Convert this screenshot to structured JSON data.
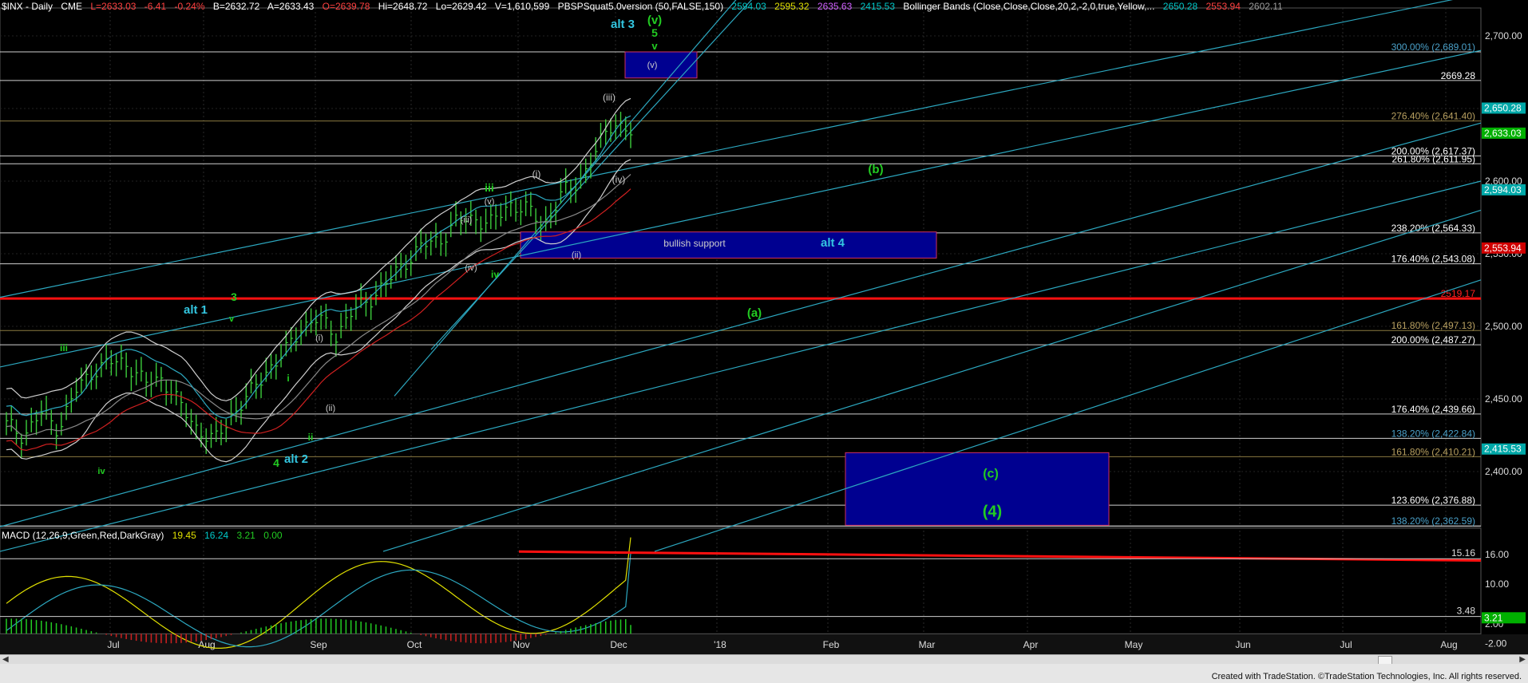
{
  "header": {
    "symbol": "$INX - Daily",
    "exchange": "CME",
    "last": "L=2633.03",
    "change": "-6.41",
    "change_pct": "-0.24%",
    "bid": "B=2632.72",
    "ask": "A=2633.43",
    "open": "O=2639.78",
    "high": "Hi=2648.72",
    "low": "Lo=2629.42",
    "volume": "V=1,610,599",
    "study1": "PBSPSquat5.0version (50,FALSE,150)",
    "study1_vals": [
      "2594.03",
      "2595.32",
      "2635.63",
      "2415.53"
    ],
    "study2": "Bollinger Bands (Close,Close,Close,20,2,-2,0,true,Yellow,...",
    "study2_vals": [
      "2650.28",
      "2553.94",
      "2602.11"
    ]
  },
  "macd_header": {
    "label": "MACD (12,26,9,Green,Red,DarkGray)",
    "vals": [
      "19.45",
      "16.24",
      "3.21",
      "0.00"
    ]
  },
  "price_axis": {
    "ticks": [
      "2,700.00",
      "2,650.00",
      "2,600.00",
      "2,550.00",
      "2,500.00",
      "2,450.00",
      "2,400.00"
    ],
    "flags": [
      {
        "text": "2,650.28",
        "bg": "#00a8a8"
      },
      {
        "text": "2,633.03",
        "bg": "#00b000"
      },
      {
        "text": "2,594.03",
        "bg": "#00a8a8"
      },
      {
        "text": "2,553.94",
        "bg": "#d00000"
      },
      {
        "text": "2,415.53",
        "bg": "#00a8a8"
      }
    ]
  },
  "macd_axis": {
    "ticks": [
      "16.00",
      "10.00",
      "2.00",
      "-2.00"
    ],
    "flags": [
      {
        "text": "3.21",
        "bg": "#00b000"
      }
    ],
    "right_labels": [
      "15.16",
      "3.48"
    ]
  },
  "time_axis": [
    "Jul",
    "Aug",
    "Sep",
    "Oct",
    "Nov",
    "Dec",
    "'18",
    "Feb",
    "Mar",
    "Apr",
    "May",
    "Jun",
    "Jul",
    "Aug"
  ],
  "fib_levels": [
    {
      "label": "300.00% (2,689.01)",
      "price": 2689.01,
      "color": "#4aa0c8"
    },
    {
      "label": "2669.28",
      "price": 2669.28,
      "color": "#ffffff"
    },
    {
      "label": "276.40% (2,641.40)",
      "price": 2641.4,
      "color": "#b8a060"
    },
    {
      "label": "200.00% (2,617.37)",
      "price": 2617.37,
      "color": "#ffffff"
    },
    {
      "label": "261.80% (2,611.95)",
      "price": 2611.95,
      "color": "#ffffff"
    },
    {
      "label": "238.20% (2,564.33)",
      "price": 2564.33,
      "color": "#ffffff"
    },
    {
      "label": "176.40% (2,543.08)",
      "price": 2543.08,
      "color": "#ffffff"
    },
    {
      "label": "2519.17",
      "price": 2519.17,
      "color": "#ff2020"
    },
    {
      "label": "161.80% (2,497.13)",
      "price": 2497.13,
      "color": "#b8a060"
    },
    {
      "label": "200.00% (2,487.27)",
      "price": 2487.27,
      "color": "#ffffff"
    },
    {
      "label": "176.40% (2,439.66)",
      "price": 2439.66,
      "color": "#ffffff"
    },
    {
      "label": "138.20% (2,422.84)",
      "price": 2422.84,
      "color": "#4aa0c8"
    },
    {
      "label": "161.80% (2,410.21)",
      "price": 2410.21,
      "color": "#b8a060"
    },
    {
      "label": "123.60% (2,376.88)",
      "price": 2376.88,
      "color": "#ffffff"
    },
    {
      "label": "138.20% (2,362.59)",
      "price": 2362.59,
      "color": "#4aa0c8"
    }
  ],
  "boxes": {
    "target_v": "(v)",
    "bullish_support": "bullish support",
    "alt4": "alt 4",
    "target_c": "(c)",
    "target_4": "(4)"
  },
  "wave_labels": [
    {
      "t": "alt 3",
      "color": "#33c6e0"
    },
    {
      "t": "(v)",
      "color": "#22cc22"
    },
    {
      "t": "5",
      "color": "#22cc22"
    },
    {
      "t": "v",
      "color": "#22cc22"
    },
    {
      "t": "(iii)",
      "color": "#cccccc"
    },
    {
      "t": "(iv)",
      "color": "#cccccc"
    },
    {
      "t": "(i)",
      "color": "#cccccc"
    },
    {
      "t": "iii",
      "color": "#22cc22"
    },
    {
      "t": "(v)",
      "color": "#cccccc"
    },
    {
      "t": "(iii)",
      "color": "#cccccc"
    },
    {
      "t": "(iv)",
      "color": "#cccccc"
    },
    {
      "t": "iv",
      "color": "#22cc22"
    },
    {
      "t": "(ii)",
      "color": "#cccccc"
    },
    {
      "t": "(b)",
      "color": "#22cc22"
    },
    {
      "t": "(a)",
      "color": "#22cc22"
    },
    {
      "t": "alt 1",
      "color": "#33c6e0"
    },
    {
      "t": "3",
      "color": "#22cc22"
    },
    {
      "t": "v",
      "color": "#22cc22"
    },
    {
      "t": "iii",
      "color": "#22cc22"
    },
    {
      "t": "(i)",
      "color": "#cccccc"
    },
    {
      "t": "i",
      "color": "#22cc22"
    },
    {
      "t": "(ii)",
      "color": "#cccccc"
    },
    {
      "t": "ii",
      "color": "#22cc22"
    },
    {
      "t": "4",
      "color": "#22cc22"
    },
    {
      "t": "alt 2",
      "color": "#33c6e0"
    },
    {
      "t": "iv",
      "color": "#22cc22"
    }
  ],
  "chart_data": {
    "type": "bar",
    "title": "$INX - Daily",
    "ylim": [
      2345,
      2725
    ],
    "series": [
      {
        "name": "$INX",
        "approx_closes": [
          2432,
          2425,
          2440,
          2430,
          2455,
          2470,
          2475,
          2475,
          2460,
          2465,
          2445,
          2430,
          2420,
          2440,
          2452,
          2470,
          2480,
          2500,
          2505,
          2495,
          2510,
          2520,
          2530,
          2545,
          2555,
          2560,
          2572,
          2575,
          2570,
          2585,
          2580,
          2570,
          2590,
          2600,
          2620,
          2642,
          2633
        ]
      },
      {
        "name": "MACD",
        "values": [
          19.45
        ]
      },
      {
        "name": "Signal",
        "values": [
          16.24
        ]
      },
      {
        "name": "Histogram",
        "values": [
          3.21
        ]
      }
    ],
    "x_labels": [
      "Jul",
      "Aug",
      "Sep",
      "Oct",
      "Nov",
      "Dec",
      "'18",
      "Feb",
      "Mar",
      "Apr",
      "May",
      "Jun",
      "Jul",
      "Aug"
    ]
  },
  "footer": "Created with TradeStation. ©TradeStation Technologies, Inc. All rights reserved."
}
